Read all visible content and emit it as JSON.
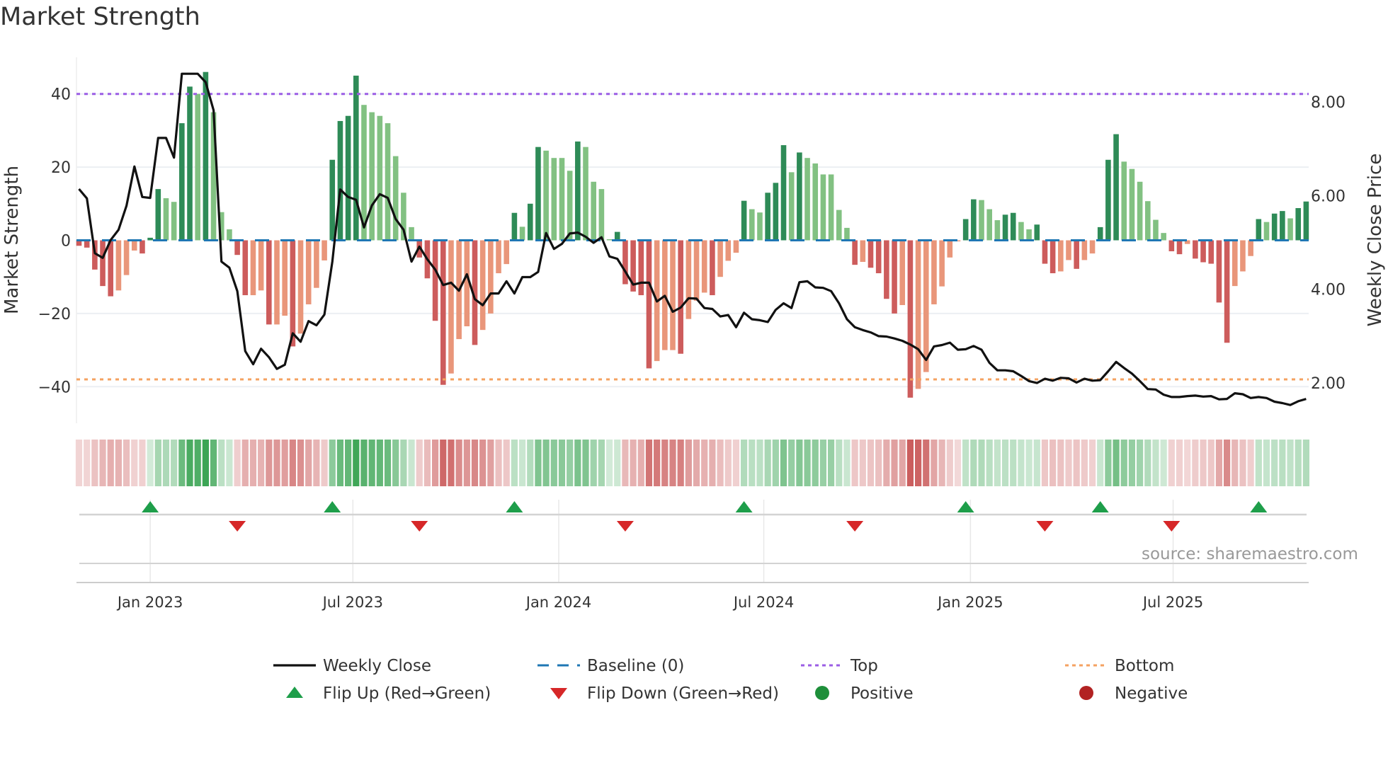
{
  "chart_data": {
    "type": "bar",
    "title": "Market Strength",
    "ylabel": "Market Strength",
    "y2label": "Weekly Close Price",
    "xlabel": "",
    "ylim": [
      -50,
      50
    ],
    "y2lim": [
      1.14,
      8.95
    ],
    "y_ticks": [
      {
        "value": 40,
        "label": "40"
      },
      {
        "value": 20,
        "label": "20"
      },
      {
        "value": 0,
        "label": "0"
      },
      {
        "value": -20,
        "label": "−20"
      },
      {
        "value": -40,
        "label": "−40"
      }
    ],
    "y2_ticks": [
      {
        "value": 8,
        "label": "8.00"
      },
      {
        "value": 6,
        "label": "6.00"
      },
      {
        "value": 4,
        "label": "4.00"
      },
      {
        "value": 2,
        "label": "2.00"
      }
    ],
    "x_ticks": [
      {
        "week": 9,
        "label": "Jan 2023"
      },
      {
        "week": 34.6,
        "label": "Jul 2023"
      },
      {
        "week": 60.6,
        "label": "Jan 2024"
      },
      {
        "week": 86.5,
        "label": "Jul 2024"
      },
      {
        "week": 112.6,
        "label": "Jan 2025"
      },
      {
        "week": 138.2,
        "label": "Jul 2025"
      }
    ],
    "grid": true,
    "top_level": 40,
    "bottom_level": -38,
    "baseline": 0,
    "market_strength": [
      -1.5,
      -2,
      -8,
      -12.5,
      -15.3,
      -13.7,
      -9.5,
      -2.8,
      -3.6,
      0.7,
      14,
      11.5,
      10.5,
      32,
      42,
      40,
      46,
      35,
      7.7,
      3,
      -4,
      -15,
      -15,
      -13.7,
      -23,
      -23,
      -20.6,
      -29,
      -25.5,
      -17.5,
      -13,
      -5.5,
      22,
      32.6,
      34,
      45,
      37,
      35,
      34,
      32,
      23,
      13,
      3.6,
      -4.7,
      -10.4,
      -22,
      -39.5,
      -36.4,
      -27,
      -23.5,
      -28.6,
      -24.5,
      -20,
      -9,
      -6.5,
      7.5,
      3.7,
      10,
      25.5,
      24.5,
      22.5,
      22.5,
      19,
      27,
      25.5,
      16,
      14,
      0.3,
      2.3,
      -12,
      -14,
      -15,
      -35,
      -33,
      -30,
      -30,
      -31,
      -21.5,
      -16.5,
      -14.3,
      -15,
      -10,
      -5.6,
      -3.4,
      10.8,
      8.5,
      7.6,
      13,
      15.7,
      26,
      18.6,
      24,
      22.5,
      21,
      18,
      18,
      8.3,
      3.4,
      -6.7,
      -5.9,
      -7.5,
      -9,
      -16,
      -20,
      -17.7,
      -43,
      -40.6,
      -36,
      -17.5,
      -12.6,
      -4.7,
      -0.3,
      5.8,
      11.2,
      11,
      8.5,
      5.5,
      7,
      7.5,
      5,
      3,
      4.3,
      -6.4,
      -9,
      -8.5,
      -5.4,
      -7.8,
      -5.4,
      -3.6,
      3.6,
      22,
      29,
      21.5,
      19.5,
      16,
      10.7,
      5.6,
      2,
      -3,
      -3.8,
      -1,
      -5,
      -6,
      -6.4,
      -17,
      -28,
      -12.5,
      -8.5,
      -4.3,
      5.8,
      5,
      7.3,
      8,
      6,
      8.8,
      10.6
    ],
    "weekly_close": [
      6.14,
      5.94,
      4.77,
      4.67,
      5.05,
      5.27,
      5.78,
      6.62,
      5.97,
      5.95,
      7.23,
      7.23,
      6.81,
      8.6,
      8.6,
      8.6,
      8.42,
      7.82,
      4.59,
      4.46,
      3.96,
      2.68,
      2.4,
      2.73,
      2.55,
      2.3,
      2.39,
      3.06,
      2.88,
      3.32,
      3.23,
      3.46,
      4.59,
      6.13,
      5.97,
      5.91,
      5.32,
      5.79,
      6.03,
      5.95,
      5.5,
      5.27,
      4.59,
      4.91,
      4.64,
      4.42,
      4.09,
      4.14,
      3.97,
      4.32,
      3.79,
      3.66,
      3.91,
      3.91,
      4.17,
      3.91,
      4.26,
      4.26,
      4.37,
      5.2,
      4.86,
      4.97,
      5.19,
      5.21,
      5.12,
      4.99,
      5.11,
      4.7,
      4.65,
      4.38,
      4.1,
      4.14,
      4.14,
      3.74,
      3.86,
      3.52,
      3.61,
      3.81,
      3.8,
      3.6,
      3.58,
      3.42,
      3.45,
      3.19,
      3.5,
      3.36,
      3.34,
      3.3,
      3.56,
      3.7,
      3.6,
      4.15,
      4.17,
      4.04,
      4.03,
      3.96,
      3.7,
      3.36,
      3.19,
      3.13,
      3.08,
      3.0,
      2.99,
      2.95,
      2.9,
      2.82,
      2.72,
      2.49,
      2.78,
      2.81,
      2.86,
      2.71,
      2.72,
      2.79,
      2.71,
      2.43,
      2.27,
      2.27,
      2.25,
      2.15,
      2.04,
      2.0,
      2.09,
      2.05,
      2.11,
      2.1,
      2.01,
      2.09,
      2.05,
      2.06,
      2.25,
      2.45,
      2.32,
      2.2,
      2.04,
      1.87,
      1.86,
      1.75,
      1.7,
      1.7,
      1.72,
      1.73,
      1.71,
      1.72,
      1.65,
      1.66,
      1.78,
      1.76,
      1.68,
      1.7,
      1.68,
      1.6,
      1.57,
      1.53,
      1.61,
      1.66
    ],
    "flip_up_weeks": [
      9,
      32,
      55,
      84,
      112,
      129,
      149
    ],
    "flip_down_weeks": [
      20,
      43,
      69,
      98,
      122,
      138
    ],
    "legend": {
      "placement": "bottom",
      "items": [
        {
          "label": "Weekly Close",
          "kind": "line"
        },
        {
          "label": "Baseline (0)",
          "kind": "dash"
        },
        {
          "label": "Top",
          "kind": "dot-top"
        },
        {
          "label": "Bottom",
          "kind": "dot-bottom"
        },
        {
          "label": "Flip Up (Red→Green)",
          "kind": "tri-up"
        },
        {
          "label": "Flip Down (Green→Red)",
          "kind": "tri-down"
        },
        {
          "label": "Positive",
          "kind": "circle-pos"
        },
        {
          "label": "Negative",
          "kind": "circle-neg"
        }
      ]
    },
    "source": "source: sharemaestro.com"
  },
  "colors": {
    "pos_strong": "#2e8b57",
    "pos_weak": "#82c182",
    "neg_strong": "#cd5c5c",
    "neg_weak": "#e9967a",
    "line": "#111111",
    "baseline": "#1f77b4",
    "top": "#9b5de5",
    "bottom": "#f4a261",
    "flip_up": "#1e9e4a",
    "flip_down": "#d62728",
    "positive": "#1e8f3a",
    "negative": "#b22222",
    "grid": "#eceff3"
  }
}
